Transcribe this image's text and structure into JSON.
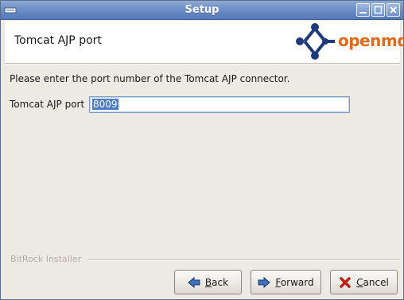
{
  "window": {
    "title": "Setup"
  },
  "header": {
    "title": "Tomcat AJP port",
    "logo": {
      "part1": "open",
      "part2": "mdx"
    }
  },
  "main": {
    "prompt": "Please enter the port number of the Tomcat AJP connector.",
    "port_label": "Tomcat AJP port",
    "port_value": "8009"
  },
  "footer": {
    "installer_label": "BitRock Installer"
  },
  "buttons": {
    "back": {
      "accel": "B",
      "rest": "ack"
    },
    "forward": {
      "accel": "F",
      "rest": "orward"
    },
    "cancel": {
      "accel": "C",
      "rest": "ancel"
    }
  },
  "colors": {
    "accent_blue": "#1e3a7b",
    "logo_orange": "#e26a1b",
    "cancel_red": "#c0201b"
  }
}
